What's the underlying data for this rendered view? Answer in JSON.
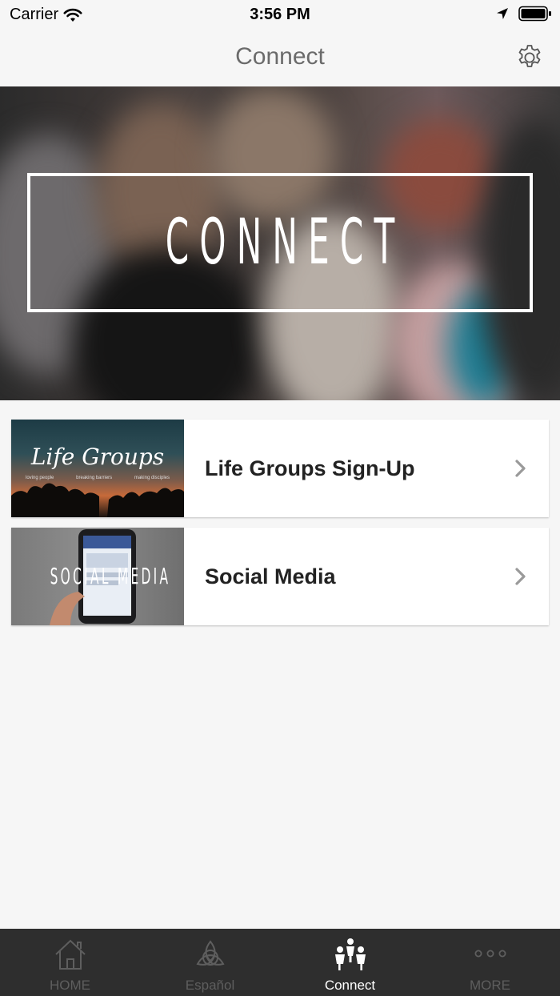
{
  "status_bar": {
    "carrier": "Carrier",
    "time": "3:56 PM"
  },
  "nav": {
    "title": "Connect",
    "settings_icon": "gear-icon"
  },
  "hero": {
    "text": "CONNECT"
  },
  "list": [
    {
      "label": "Life Groups Sign-Up",
      "thumb_title": "Life Groups",
      "thumb_taglines": [
        "loving people",
        "breaking barriers",
        "making disciples"
      ]
    },
    {
      "label": "Social Media",
      "thumb_title": "SOCIAL MEDIA"
    }
  ],
  "tabs": [
    {
      "label": "HOME",
      "icon": "home-icon",
      "active": false
    },
    {
      "label": "Español",
      "icon": "triquetra-icon",
      "active": false
    },
    {
      "label": "Connect",
      "icon": "people-icon",
      "active": true
    },
    {
      "label": "MORE",
      "icon": "more-dots-icon",
      "active": false
    }
  ],
  "colors": {
    "background": "#f6f6f6",
    "tab_bar": "#2e2e2e",
    "tab_active": "#ffffff",
    "tab_inactive": "#5e5e5e",
    "nav_title": "#6b6b6b"
  }
}
